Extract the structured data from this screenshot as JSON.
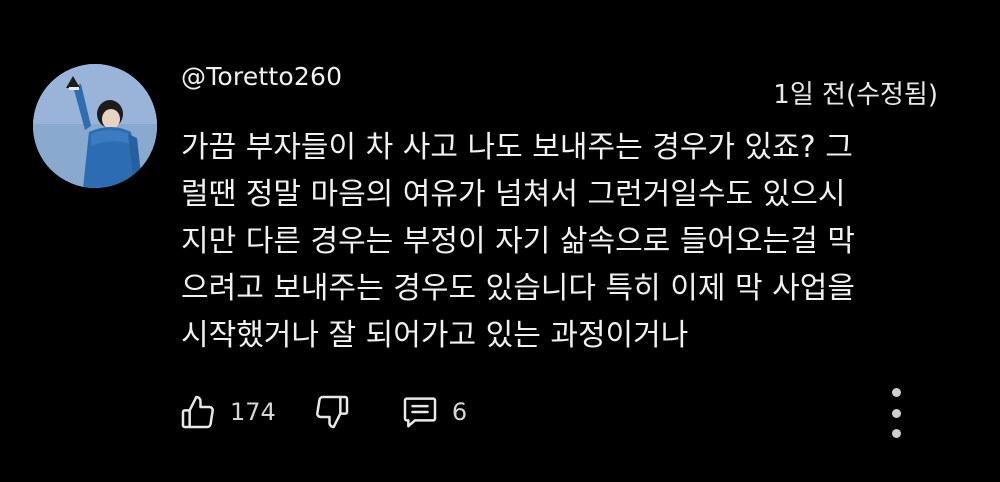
{
  "comment": {
    "author": "@Toretto260",
    "timestamp": "1일 전(수정됨)",
    "body": "가끔 부자들이 차 사고 나도 보내주는 경우가 있죠? 그\n럴땐 정말 마음의 여유가 넘쳐서 그런거일수도 있으시\n지만 다른 경우는 부정이 자기 삶속으로 들어오는걸 막\n으려고 보내주는 경우도 있습니다 특히 이제 막 사업을\n시작했거나 잘 되어가고 있는 과정이거나",
    "likes": "174",
    "replies": "6"
  },
  "icons": {
    "like": "thumbs-up-icon",
    "dislike": "thumbs-down-icon",
    "reply": "comment-icon",
    "more": "more-vertical-icon"
  },
  "colors": {
    "background": "#000000",
    "text": "#f1f1f1",
    "secondary": "#d6d6d6"
  }
}
